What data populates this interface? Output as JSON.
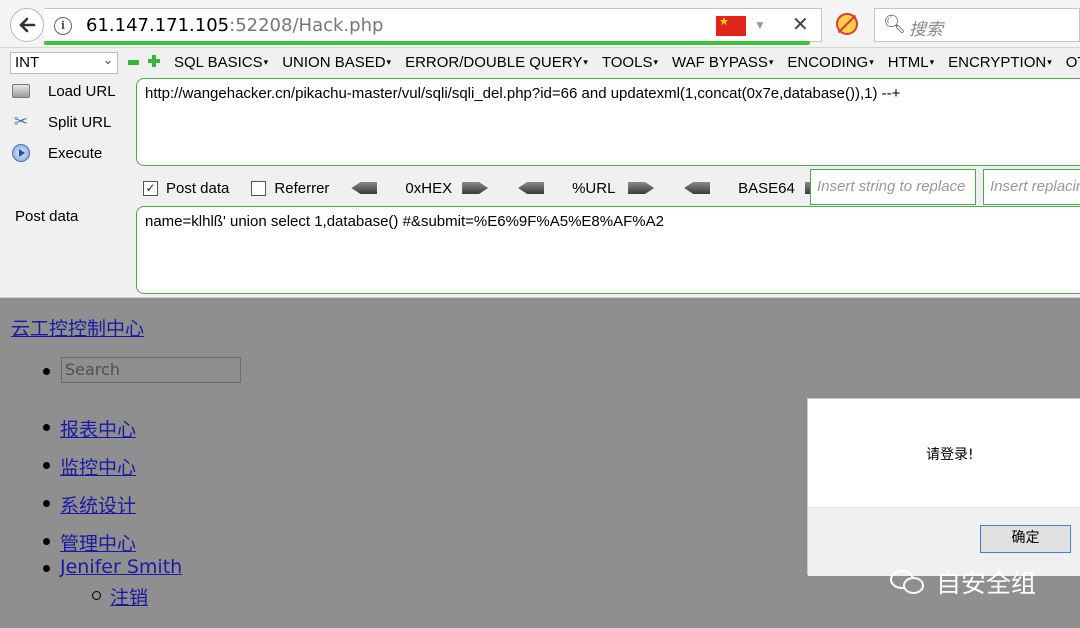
{
  "browser": {
    "url_host": "61.147.171.105",
    "url_rest": ":52208/Hack.php",
    "search_placeholder": "搜索"
  },
  "hackbar": {
    "type_select": "INT",
    "menu": [
      "SQL BASICS",
      "UNION BASED",
      "ERROR/DOUBLE QUERY",
      "TOOLS",
      "WAF BYPASS",
      "ENCODING",
      "HTML",
      "ENCRYPTION",
      "OTHER"
    ],
    "load_url": "Load URL",
    "split_url": "Split URL",
    "execute": "Execute",
    "url_value": "http://wangehacker.cn/pikachu-master/vul/sqli/sqli_del.php?id=66  and updatexml(1,concat(0x7e,database()),1) --+",
    "post_data_checkbox": "Post data",
    "post_data_checked": true,
    "referrer_checkbox": "Referrer",
    "referrer_checked": false,
    "encoders": [
      "0xHEX",
      "%URL",
      "BASE64"
    ],
    "replace_placeholder_1": "Insert string to replace",
    "replace_placeholder_2": "Insert replacing string",
    "post_data_label": "Post data",
    "post_value": "name=klhlß' union select 1,database() #&submit=%E6%9F%A5%E8%AF%A2"
  },
  "page": {
    "site_title": "云工控控制中心",
    "search_placeholder": "Search",
    "nav": [
      "报表中心",
      "监控中心",
      "系统设计",
      "管理中心"
    ],
    "user": "Jenifer Smith",
    "logout": "注销"
  },
  "dialog": {
    "message": "请登录!",
    "ok": "确定"
  },
  "watermark": "自安全组",
  "colors": {
    "accent_green": "#4fa84f",
    "link_blue": "#1a1aa6",
    "overlay_gray": "#8f8f8f"
  }
}
